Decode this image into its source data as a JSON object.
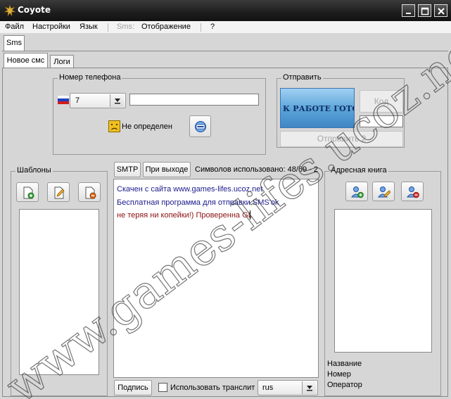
{
  "window": {
    "title": "Coyote"
  },
  "menu": {
    "file": "Файл",
    "settings": "Настройки",
    "language": "Язык",
    "sms": "Sms:",
    "display": "Отображение",
    "help": "?"
  },
  "top_tab": "Sms",
  "tabs": {
    "new_sms": "Новое смс",
    "logs": "Логи"
  },
  "phone": {
    "group_title": "Номер телефона",
    "prefix": "7",
    "number_value": "",
    "status": "Не определен"
  },
  "send": {
    "group_title": "Отправить",
    "captcha_text": "К РАБОТЕ ГОТОВ",
    "code_button": "Код",
    "code_value": "",
    "send2_button": "Отправить 2"
  },
  "templates": {
    "group_title": "Шаблоны"
  },
  "message": {
    "smtp_tab": "SMTP",
    "on_exit_tab": "При выходе",
    "counter": "Символов использовано:  48/69 - 2",
    "lines": [
      "Скачен с сайта www.games-lifes.ucoz.net",
      "Бесплатная программа для отправки SMS'ok",
      "не теряя ни копейки!) Проверенна GL"
    ],
    "signature_tab": "Подпись",
    "translit_label": "Использовать транслит",
    "translit_checked": false,
    "language": "rus"
  },
  "address_book": {
    "group_title": "Адресная книга",
    "name_label": "Название",
    "number_label": "Номер",
    "operator_label": "Оператор"
  },
  "watermark": "www.games-lifes.ucoz.net",
  "colors": {
    "titlebar": "#1e1e1e",
    "panel": "#d6d6d6",
    "message_blue": "#1a1a8c",
    "message_red": "#8b1010",
    "captcha_blue": "#5aa3d8"
  }
}
